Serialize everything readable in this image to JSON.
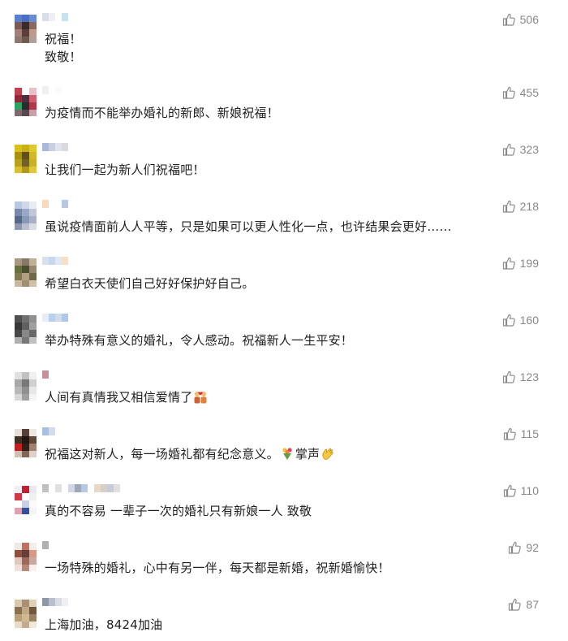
{
  "comments": [
    {
      "text_lines": [
        "祝福！",
        "致敬！"
      ],
      "likes": "506"
    },
    {
      "text_lines": [
        "为疫情而不能举办婚礼的新郎、新娘祝福！"
      ],
      "likes": "455"
    },
    {
      "text_lines": [
        "让我们一起为新人们祝福吧！"
      ],
      "likes": "323"
    },
    {
      "text_lines": [
        "虽说疫情面前人人平等，只是如果可以更人性化一点，也许结果会更好……"
      ],
      "likes": "218"
    },
    {
      "text_lines": [
        "希望白衣天使们自己好好保护好自己。"
      ],
      "likes": "199"
    },
    {
      "text_lines": [
        "举办特殊有意义的婚礼，令人感动。祝福新人一生平安！"
      ],
      "likes": "160"
    },
    {
      "text_lines": [
        "人间有真情我又相信爱情了"
      ],
      "likes": "123",
      "emoji": "couple-with-heart-emoji"
    },
    {
      "text_lines": [
        "祝福这对新人，每一场婚礼都有纪念意义。",
        "掌声"
      ],
      "likes": "115",
      "emoji": [
        "bouquet-emoji",
        "clapping-hands-emoji"
      ]
    },
    {
      "text_lines": [
        "真的不容易 一辈子一次的婚礼只有新娘一人 致敬"
      ],
      "likes": "110"
    },
    {
      "text_lines": [
        "一场特殊的婚礼，心中有另一伴，每天都是新婚，祝新婚愉快！"
      ],
      "likes": "92"
    },
    {
      "text_lines": [
        "上海加油，8424加油"
      ],
      "likes": "87"
    }
  ],
  "colors": {
    "like_icon": "#8a8a8a",
    "like_count": "#888888",
    "text": "#1f1f1f"
  },
  "icons": {
    "like": "thumbs-up-icon"
  }
}
